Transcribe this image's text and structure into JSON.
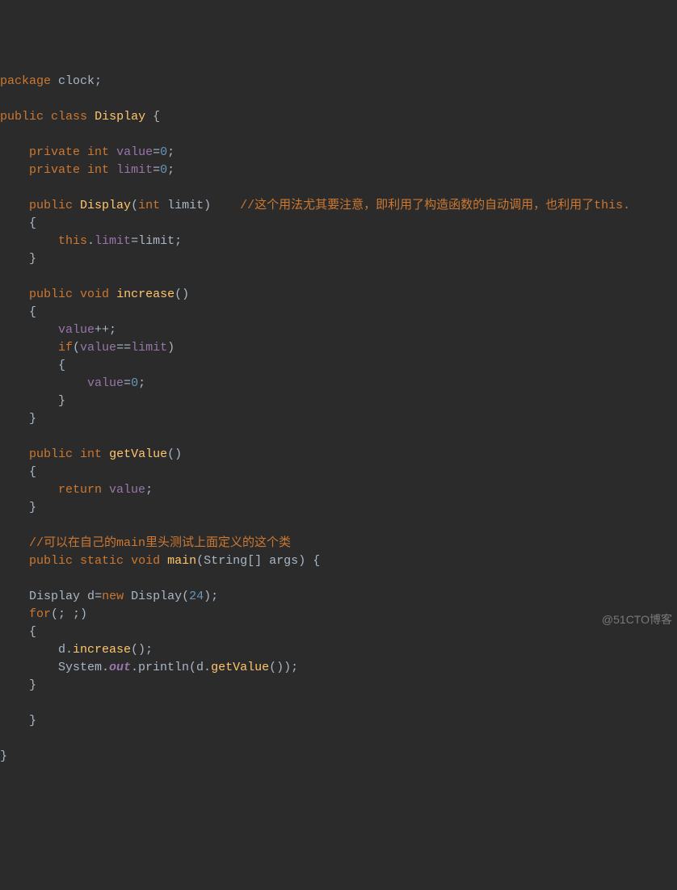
{
  "code": {
    "l1_a": "package",
    "l1_b": " clock;",
    "l2": "",
    "l3_a": "public",
    "l3_b": " ",
    "l3_c": "class",
    "l3_d": " ",
    "l3_e": "Display",
    "l3_f": " {",
    "l4": "",
    "l5_a": "    ",
    "l5_b": "private",
    "l5_c": " ",
    "l5_d": "int",
    "l5_e": " ",
    "l5_f": "value",
    "l5_g": "=",
    "l5_h": "0",
    "l5_i": ";",
    "l6_a": "    ",
    "l6_b": "private",
    "l6_c": " ",
    "l6_d": "int",
    "l6_e": " ",
    "l6_f": "limit",
    "l6_g": "=",
    "l6_h": "0",
    "l6_i": ";",
    "l7": "",
    "l8_a": "    ",
    "l8_b": "public",
    "l8_c": " ",
    "l8_d": "Display",
    "l8_e": "(",
    "l8_f": "int",
    "l8_g": " ",
    "l8_h": "limit",
    "l8_i": ")    ",
    "l8_j": "//这个用法尤其要注意，即利用了构造函数的自动调用，也利用了this.",
    "l9": "    {",
    "l10_a": "        ",
    "l10_b": "this",
    "l10_c": ".",
    "l10_d": "limit",
    "l10_e": "=limit;",
    "l11": "    }",
    "l12": "",
    "l13_a": "    ",
    "l13_b": "public",
    "l13_c": " ",
    "l13_d": "void",
    "l13_e": " ",
    "l13_f": "increase",
    "l13_g": "()",
    "l14": "    {",
    "l15_a": "        ",
    "l15_b": "value",
    "l15_c": "++;",
    "l16_a": "        ",
    "l16_b": "if",
    "l16_c": "(",
    "l16_d": "value",
    "l16_e": "==",
    "l16_f": "limit",
    "l16_g": ")",
    "l17": "        {",
    "l18_a": "            ",
    "l18_b": "value",
    "l18_c": "=",
    "l18_d": "0",
    "l18_e": ";",
    "l19": "        }",
    "l20": "    }",
    "l21": "",
    "l22_a": "    ",
    "l22_b": "public",
    "l22_c": " ",
    "l22_d": "int",
    "l22_e": " ",
    "l22_f": "getValue",
    "l22_g": "()",
    "l23": "    {",
    "l24_a": "        ",
    "l24_b": "return",
    "l24_c": " ",
    "l24_d": "value",
    "l24_e": ";",
    "l25": "    }",
    "l26": "",
    "l27_a": "    ",
    "l27_b": "//可以在自己的main里头测试上面定义的这个类",
    "l28_a": "    ",
    "l28_b": "public",
    "l28_c": " ",
    "l28_d": "static",
    "l28_e": " ",
    "l28_f": "void",
    "l28_g": " ",
    "l28_h": "main",
    "l28_i": "(",
    "l28_j": "String",
    "l28_k": "[] ",
    "l28_l": "args",
    "l28_m": ") {",
    "l29": "",
    "l30_a": "    ",
    "l30_b": "Display",
    "l30_c": " ",
    "l30_d": "d",
    "l30_e": "=",
    "l30_f": "new",
    "l30_g": " ",
    "l30_h": "Display",
    "l30_i": "(",
    "l30_j": "24",
    "l30_k": ");",
    "l31_a": "    ",
    "l31_b": "for",
    "l31_c": "(; ;)",
    "l32": "    {",
    "l33_a": "        d.",
    "l33_b": "increase",
    "l33_c": "();",
    "l34_a": "        System.",
    "l34_b": "out",
    "l34_c": ".println(d.",
    "l34_d": "getValue",
    "l34_e": "());",
    "l35": "    }",
    "l36": "",
    "l37": "    }",
    "l38": "",
    "l39": "}"
  },
  "watermark": "@51CTO博客"
}
